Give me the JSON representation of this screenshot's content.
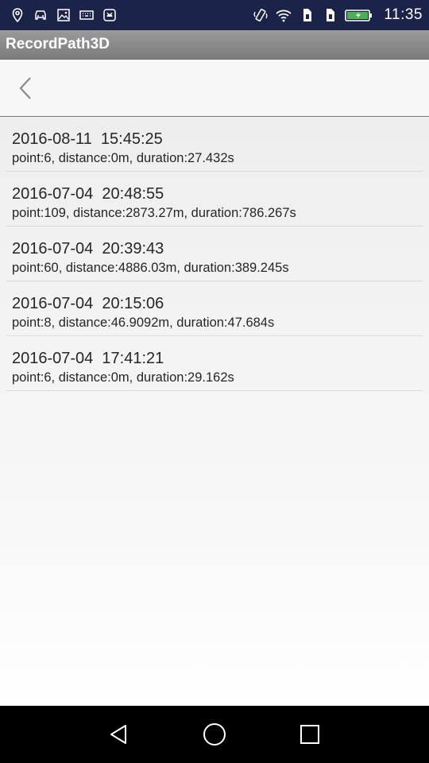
{
  "status_bar": {
    "time": "11:35",
    "colors": {
      "background": "#1b2349",
      "battery_fill": "#4caf50"
    },
    "left_icons": [
      "location-icon",
      "car-icon",
      "image-icon",
      "keyboard-icon",
      "android-debug-icon"
    ],
    "right_icons": [
      "vibrate-icon",
      "wifi-icon",
      "sim1-icon",
      "sim2-icon",
      "battery-charging-icon"
    ]
  },
  "app": {
    "title": "RecordPath3D"
  },
  "toolbar": {
    "back_icon": "chevron-left-icon"
  },
  "records": [
    {
      "time": "2016-08-11  15:45:25",
      "info": "point:6, distance:0m, duration:27.432s"
    },
    {
      "time": "2016-07-04  20:48:55",
      "info": "point:109, distance:2873.27m, duration:786.267s"
    },
    {
      "time": "2016-07-04  20:39:43",
      "info": "point:60, distance:4886.03m, duration:389.245s"
    },
    {
      "time": "2016-07-04  20:15:06",
      "info": "point:8, distance:46.9092m, duration:47.684s"
    },
    {
      "time": "2016-07-04  17:41:21",
      "info": "point:6, distance:0m, duration:29.162s"
    }
  ],
  "nav_bar": {
    "icons": [
      "nav-back-icon",
      "nav-home-icon",
      "nav-recent-icon"
    ]
  }
}
